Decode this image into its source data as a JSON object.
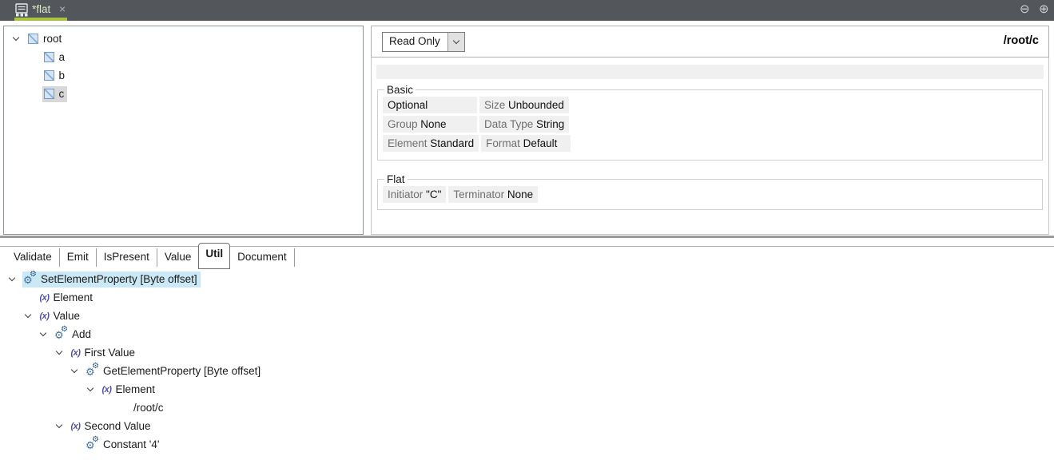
{
  "titlebar": {
    "tab_label": "*flat",
    "close_label": "×",
    "minimize_glyph": "⊖",
    "maximize_glyph": "⊕",
    "accent_color": "#a9c23f"
  },
  "schema_tree": {
    "items": [
      {
        "label": "root",
        "level": 0,
        "icon": "element",
        "chevron": true,
        "selected": false
      },
      {
        "label": "a",
        "level": 1,
        "icon": "element",
        "chevron": false,
        "selected": false
      },
      {
        "label": "b",
        "level": 1,
        "icon": "element",
        "chevron": false,
        "selected": false
      },
      {
        "label": "c",
        "level": 1,
        "icon": "element",
        "chevron": false,
        "selected": true
      }
    ]
  },
  "properties": {
    "mode_select": {
      "value": "Read Only"
    },
    "path": "/root/c",
    "groups": [
      {
        "legend": "Basic",
        "rows": [
          [
            {
              "label": "",
              "value": "Optional"
            },
            {
              "label": "Size",
              "value": "Unbounded"
            }
          ],
          [
            {
              "label": "Group",
              "value": "None"
            },
            {
              "label": "Data Type",
              "value": "String"
            }
          ],
          [
            {
              "label": "Element",
              "value": "Standard"
            },
            {
              "label": "Format",
              "value": "Default"
            }
          ]
        ]
      },
      {
        "legend": "Flat",
        "rows": [
          [
            {
              "label": "Initiator",
              "value": "\"C\""
            },
            {
              "label": "Terminator",
              "value": "None"
            }
          ]
        ]
      }
    ]
  },
  "bottom": {
    "tabs": [
      {
        "label": "Validate",
        "active": false
      },
      {
        "label": "Emit",
        "active": false
      },
      {
        "label": "IsPresent",
        "active": false
      },
      {
        "label": "Value",
        "active": false
      },
      {
        "label": "Util",
        "active": true
      },
      {
        "label": "Document",
        "active": false
      }
    ],
    "tree": [
      {
        "label": "SetElementProperty [Byte offset]",
        "level": 0,
        "icon": "gear",
        "chevron": true,
        "selected": true
      },
      {
        "label": "Element",
        "level": 1,
        "icon": "x",
        "chevron": false,
        "selected": false
      },
      {
        "label": "Value",
        "level": 1,
        "icon": "x",
        "chevron": true,
        "selected": false
      },
      {
        "label": "Add",
        "level": 2,
        "icon": "gear",
        "chevron": true,
        "selected": false
      },
      {
        "label": "First Value",
        "level": 3,
        "icon": "x",
        "chevron": true,
        "selected": false
      },
      {
        "label": "GetElementProperty [Byte offset]",
        "level": 4,
        "icon": "gear",
        "chevron": true,
        "selected": false
      },
      {
        "label": "Element",
        "level": 5,
        "icon": "x",
        "chevron": true,
        "selected": false
      },
      {
        "label": "/root/c",
        "level": 6,
        "icon": "none",
        "chevron": false,
        "selected": false
      },
      {
        "label": "Second Value",
        "level": 3,
        "icon": "x",
        "chevron": true,
        "selected": false
      },
      {
        "label": "Constant '4'",
        "level": 4,
        "icon": "gear",
        "chevron": false,
        "selected": false
      }
    ]
  }
}
